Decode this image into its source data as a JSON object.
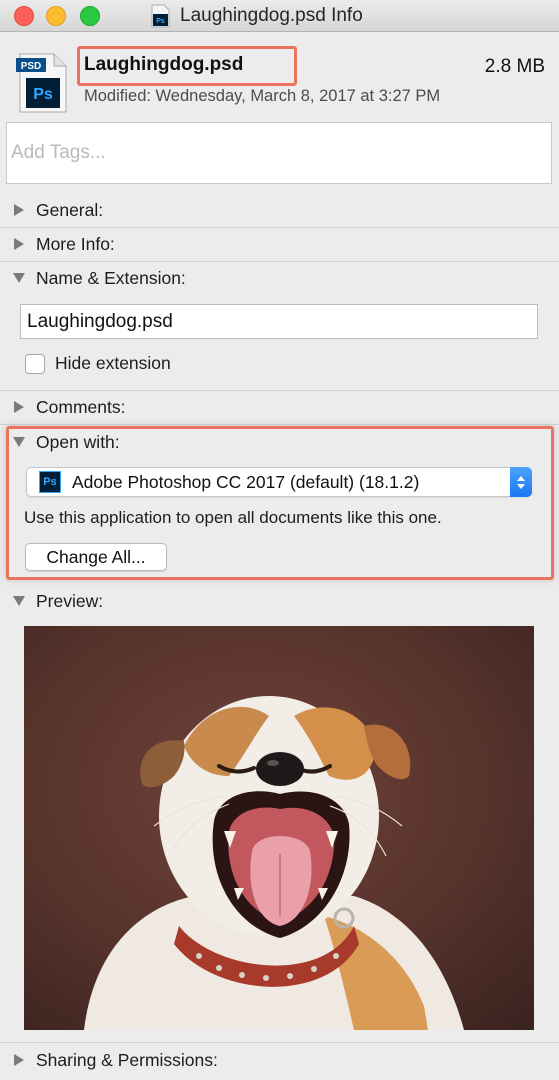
{
  "window": {
    "title": "Laughingdog.psd Info"
  },
  "file": {
    "icon_badge": "PSD",
    "icon_label": "Ps",
    "name": "Laughingdog.psd",
    "size": "2.8 MB",
    "modified": "Modified: Wednesday, March 8, 2017 at 3:27 PM"
  },
  "tags": {
    "placeholder": "Add Tags..."
  },
  "sections": {
    "general": "General:",
    "more_info": "More Info:",
    "name_extension": "Name & Extension:",
    "comments": "Comments:",
    "open_with": "Open with:",
    "preview": "Preview:",
    "sharing": "Sharing & Permissions:"
  },
  "name_extension": {
    "field_value": "Laughingdog.psd",
    "hide_extension_label": "Hide extension",
    "hide_extension_checked": false
  },
  "open_with": {
    "app_icon": "Ps",
    "selected_app": "Adobe Photoshop CC 2017 (default) (18.1.2)",
    "hint": "Use this application to open all documents like this one.",
    "change_all_label": "Change All..."
  },
  "colors": {
    "highlight": "#e9745e",
    "photoshop_blue": "#31a8ff",
    "photoshop_dark": "#001e36",
    "select_accent": "#1a78f2"
  }
}
